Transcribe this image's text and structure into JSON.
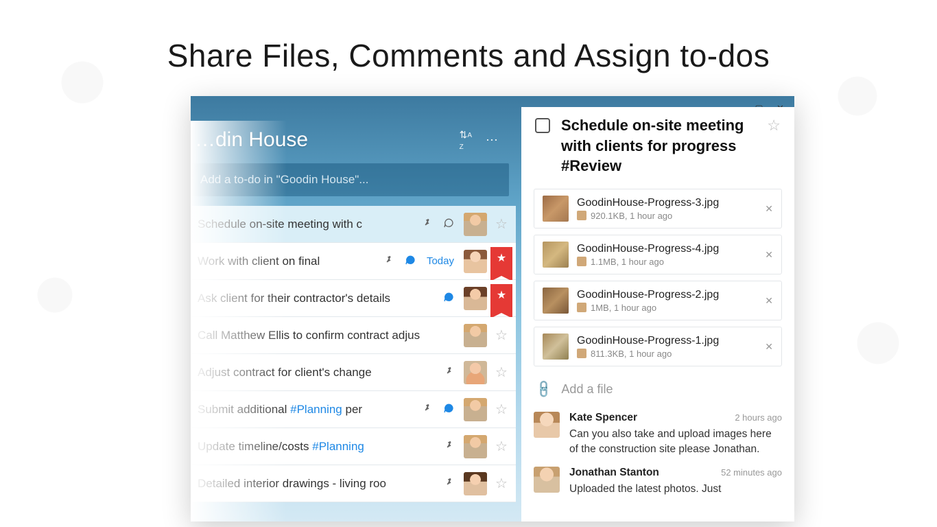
{
  "headline": "Share Files, Comments and Assign to-dos",
  "window": {
    "min": "—",
    "max": "▢",
    "close": "✕"
  },
  "list": {
    "title": "…din House",
    "add_placeholder": "Add a to-do in \"Goodin House\"...",
    "sort": "⇅",
    "more": "⋯",
    "todos": [
      {
        "text": "Schedule on-site meeting with c",
        "pin": true,
        "chat": true,
        "chatActive": false,
        "due": "",
        "avatar": "m1",
        "star": true,
        "ribbon": false,
        "selected": true
      },
      {
        "text": "Work with client on final",
        "pin": true,
        "chat": true,
        "chatActive": true,
        "due": "Today",
        "avatar": "f1",
        "star": false,
        "ribbon": true,
        "selected": false
      },
      {
        "text": "Ask client for their contractor's details",
        "pin": false,
        "chat": true,
        "chatActive": true,
        "due": "",
        "avatar": "f2",
        "star": false,
        "ribbon": true,
        "selected": false
      },
      {
        "text": "Call Matthew Ellis to confirm contract adjus",
        "pin": false,
        "chat": false,
        "chatActive": false,
        "due": "",
        "avatar": "m1",
        "star": true,
        "ribbon": false,
        "selected": false
      },
      {
        "text": "Adjust contract for client's change",
        "pin": true,
        "chat": false,
        "chatActive": false,
        "due": "",
        "avatar": "m2",
        "star": true,
        "ribbon": false,
        "selected": false
      },
      {
        "text": "Submit additional ",
        "tag": "#Planning",
        "tail": " per",
        "pin": true,
        "chat": true,
        "chatActive": true,
        "due": "",
        "avatar": "m1",
        "star": true,
        "ribbon": false,
        "selected": false
      },
      {
        "text": "Update timeline/costs ",
        "tag": "#Planning",
        "tail": "",
        "pin": true,
        "chat": false,
        "chatActive": false,
        "due": "",
        "avatar": "m1",
        "star": true,
        "ribbon": false,
        "selected": false
      },
      {
        "text": "Detailed interior drawings - living roo",
        "pin": true,
        "chat": false,
        "chatActive": false,
        "due": "",
        "avatar": "f3",
        "star": true,
        "ribbon": false,
        "selected": false
      }
    ]
  },
  "detail": {
    "title": "Schedule on-site meeting with clients for progress #Review",
    "files": [
      {
        "name": "GoodinHouse-Progress-3.jpg",
        "meta": "920.1KB, 1 hour ago",
        "thumb": "t1"
      },
      {
        "name": "GoodinHouse-Progress-4.jpg",
        "meta": "1.1MB, 1 hour ago",
        "thumb": "t2"
      },
      {
        "name": "GoodinHouse-Progress-2.jpg",
        "meta": "1MB, 1 hour ago",
        "thumb": "t3"
      },
      {
        "name": "GoodinHouse-Progress-1.jpg",
        "meta": "811.3KB, 1 hour ago",
        "thumb": "t4"
      }
    ],
    "add_file": "Add a file",
    "comments": [
      {
        "author": "Kate Spencer",
        "time": "2 hours ago",
        "text": "Can you also take and upload images here of the construction site please Jonathan.",
        "avatar": "ca1"
      },
      {
        "author": "Jonathan Stanton",
        "time": "52 minutes ago",
        "text": "Uploaded the latest photos. Just",
        "avatar": "ca2"
      }
    ]
  },
  "glyph": {
    "pin": "📌︎",
    "chat": "💬",
    "star_o": "☆",
    "star_f": "★",
    "sort": "⇅ᴬ",
    "close": "✕",
    "clip": "📎"
  }
}
